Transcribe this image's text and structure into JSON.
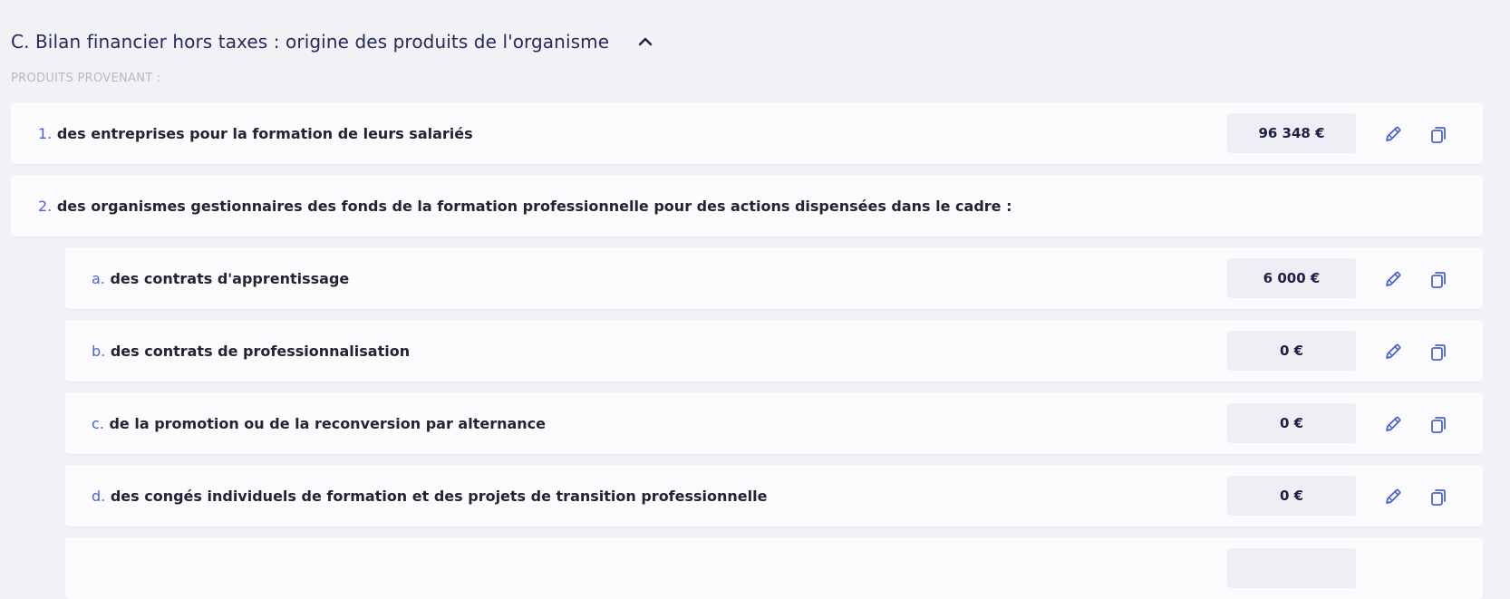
{
  "section": {
    "title": "C. Bilan financier hors taxes : origine des produits de l'organisme",
    "subheading": "PRODUITS PROVENANT :"
  },
  "rows": [
    {
      "index": "1.",
      "label": "des entreprises pour la formation de leurs salariés",
      "amount": "96 348 €"
    },
    {
      "index": "2.",
      "label": "des organismes gestionnaires des fonds de la formation professionnelle pour des actions dispensées dans le cadre :"
    },
    {
      "index": "a.",
      "label": "des contrats d'apprentissage",
      "amount": "6 000 €"
    },
    {
      "index": "b.",
      "label": "des contrats de professionnalisation",
      "amount": "0 €"
    },
    {
      "index": "c.",
      "label": "de la promotion ou de la reconversion par alternance",
      "amount": "0 €"
    },
    {
      "index": "d.",
      "label": "des congés individuels de formation et des projets de transition professionnelle",
      "amount": "0 €"
    }
  ],
  "colors": {
    "background": "#f1f1f6",
    "row_background": "#fbfbfd",
    "accent": "#4a62d4",
    "title": "#262a5e",
    "amount_background": "#eeeef4"
  },
  "icons": [
    "chevron-up-icon",
    "pencil-icon",
    "copy-icon"
  ]
}
